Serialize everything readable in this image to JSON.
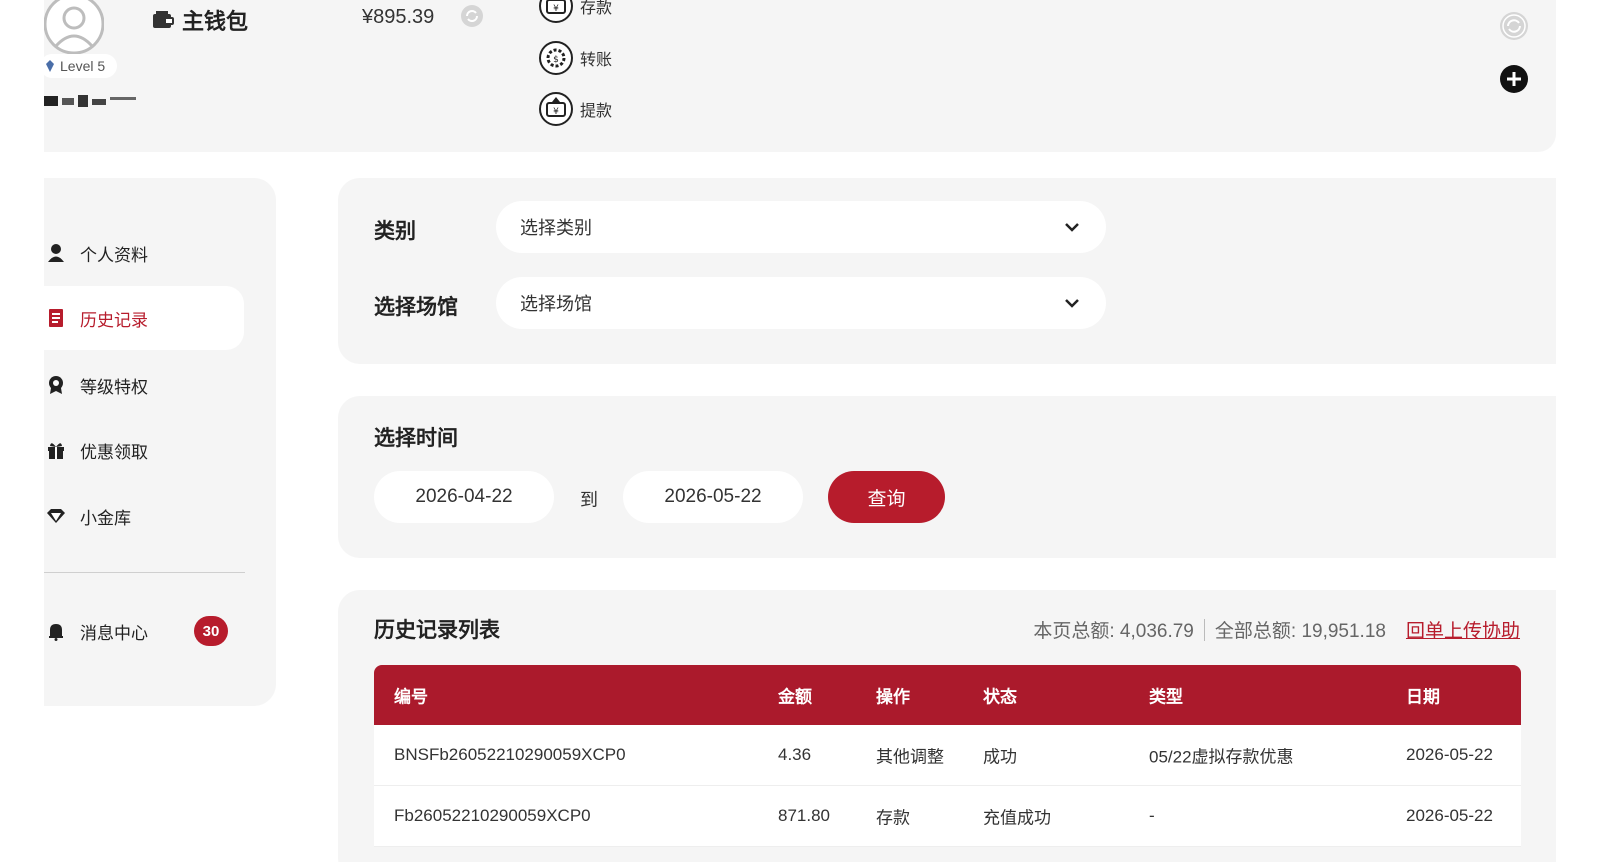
{
  "header": {
    "level_label": "Level 5",
    "wallet_title": "主钱包",
    "wallet_amount": "¥895.39",
    "actions": [
      {
        "label": "存款",
        "icon": "deposit-icon"
      },
      {
        "label": "转账",
        "icon": "transfer-icon"
      },
      {
        "label": "提款",
        "icon": "withdraw-icon"
      }
    ]
  },
  "sidebar": {
    "items": [
      {
        "label": "个人资料",
        "icon": "user-icon"
      },
      {
        "label": "历史记录",
        "icon": "document-icon",
        "active": true
      },
      {
        "label": "等级特权",
        "icon": "medal-icon"
      },
      {
        "label": "优惠领取",
        "icon": "gift-icon"
      },
      {
        "label": "小金库",
        "icon": "diamond-icon"
      }
    ],
    "message_center": {
      "label": "消息中心",
      "icon": "bell-icon",
      "badge": "30"
    }
  },
  "filters": {
    "category_label": "类别",
    "category_value": "选择类别",
    "venue_label": "选择场馆",
    "venue_value": "选择场馆"
  },
  "time": {
    "label": "选择时间",
    "start_date": "2026-04-22",
    "to_label": "到",
    "end_date": "2026-05-22",
    "query_label": "查询"
  },
  "history": {
    "title": "历史记录列表",
    "page_total": "本页总额: 4,036.79",
    "all_total": "全部总额: 19,951.18",
    "upload_link": "回单上传协助",
    "columns": [
      "编号",
      "金额",
      "操作",
      "状态",
      "类型",
      "日期"
    ],
    "rows": [
      [
        "BNSFb26052210290059XCP0",
        "4.36",
        "其他调整",
        "成功",
        "05/22虚拟存款优惠",
        "2026-05-22"
      ],
      [
        "Fb26052210290059XCP0",
        "871.80",
        "存款",
        "充值成功",
        "-",
        "2026-05-22"
      ]
    ]
  },
  "colors": {
    "accent": "#b71c2c",
    "panel_bg": "#f5f5f5",
    "header_bg": "#ab1a2c"
  }
}
